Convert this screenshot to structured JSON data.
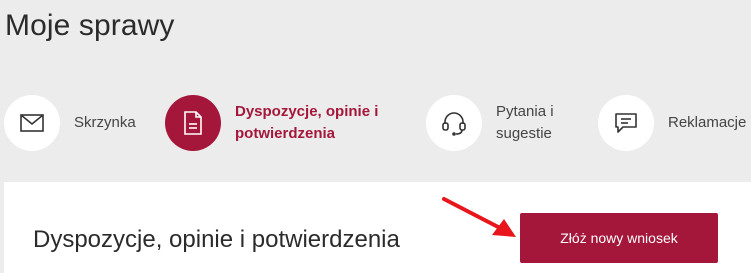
{
  "page": {
    "title": "Moje sprawy"
  },
  "tabs": [
    {
      "label_lines": [
        "Skrzynka"
      ],
      "icon": "envelope-icon",
      "active": false
    },
    {
      "label_lines": [
        "Dyspozycje, opinie i",
        "potwierdzenia"
      ],
      "icon": "document-icon",
      "active": true
    },
    {
      "label_lines": [
        "Pytania i",
        "sugestie"
      ],
      "icon": "headset-icon",
      "active": false
    },
    {
      "label_lines": [
        "Reklamacje"
      ],
      "icon": "chat-bubble-icon",
      "active": false
    }
  ],
  "panel": {
    "title": "Dyspozycje, opinie i potwierdzenia",
    "new_request_label": "Złóż nowy wniosek"
  },
  "colors": {
    "accent": "#a5173a",
    "annotation_arrow": "#e8161b",
    "background": "#ececec"
  }
}
